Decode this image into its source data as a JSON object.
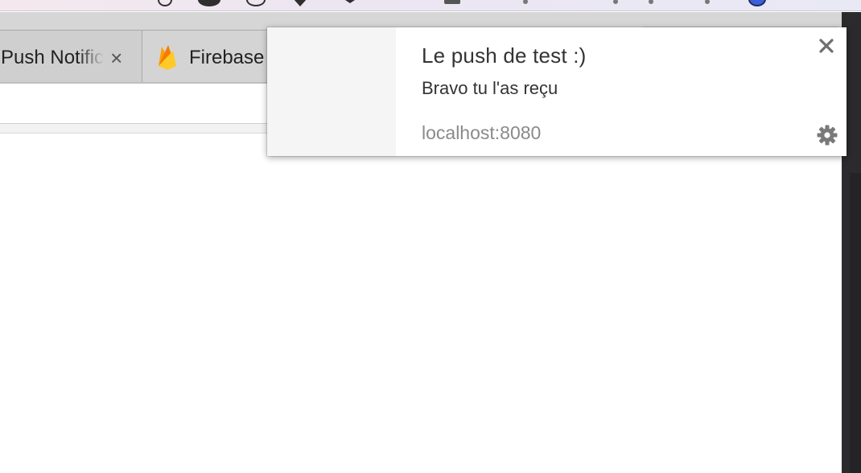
{
  "tabs": [
    {
      "title": "Push Notific",
      "close_symbol": "×",
      "icon": "none",
      "active": false
    },
    {
      "title": "Firebase",
      "icon": "firebase-icon",
      "active": false
    }
  ],
  "notification": {
    "title": "Le push de test :)",
    "message": "Bravo tu l'as reçu",
    "origin": "localhost:8080",
    "close_icon": "close-icon",
    "settings_icon": "gear-icon"
  },
  "colors": {
    "notification_text": "#333333",
    "origin_text": "#8a8a8a",
    "icon_gray": "#777777",
    "firebase_yellow": "#FFCA28",
    "firebase_orange": "#FFA000",
    "firebase_red": "#F57C00"
  }
}
